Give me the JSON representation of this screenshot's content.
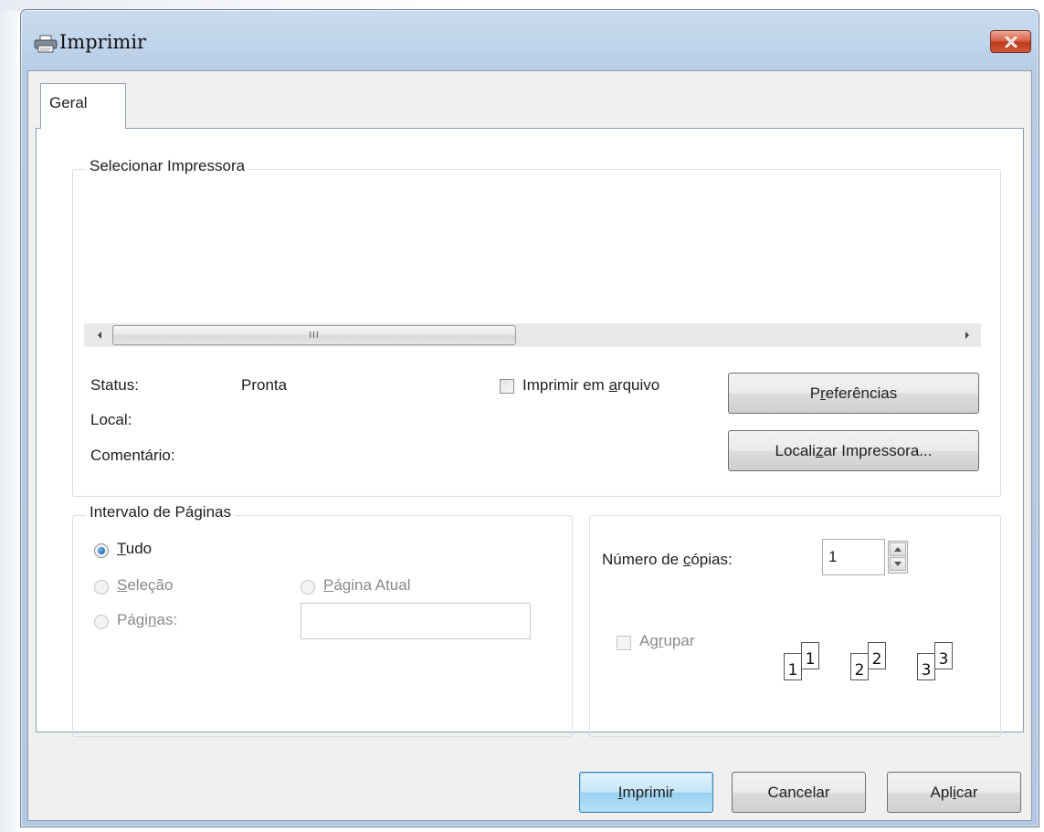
{
  "window": {
    "title": "Imprimir",
    "icon": "printer-icon",
    "close_icon": "close-icon"
  },
  "tabs": [
    {
      "label": "Geral"
    }
  ],
  "printer_group": {
    "legend": "Selecionar Impressora",
    "status_label": "Status:",
    "status_value": "Pronta",
    "local_label": "Local:",
    "comment_label": "Comentário:",
    "print_to_file": {
      "before": "Imprimir em ",
      "access": "a",
      "after": "rquivo",
      "checked": false
    },
    "preferences_button": {
      "before": "P",
      "access": "r",
      "after": "eferências"
    },
    "find_printer_button": {
      "before": "Locali",
      "access": "z",
      "after": "ar Impressora..."
    },
    "scroll_grip": "III"
  },
  "page_range": {
    "legend": "Intervalo de Páginas",
    "all": {
      "access": "T",
      "after": "udo",
      "selected": true
    },
    "selection": {
      "access": "S",
      "after": "eleção",
      "enabled": false
    },
    "current_page": {
      "access": "P",
      "after": "ágina Atual",
      "enabled": false
    },
    "pages": {
      "before": "Pági",
      "access": "n",
      "after": "as:",
      "enabled": false
    },
    "pages_input_value": ""
  },
  "copies": {
    "label_before": "Número de ",
    "label_access": "c",
    "label_after": "ópias:",
    "value": "1",
    "collate": {
      "before": "Ag",
      "access": "r",
      "after": "upar",
      "checked": false,
      "enabled": false
    },
    "collate_pages": [
      "1",
      "2",
      "3"
    ]
  },
  "buttons": {
    "print": {
      "access": "I",
      "after": "mprimir"
    },
    "cancel": {
      "label": "Cancelar"
    },
    "apply": {
      "before": "Apl",
      "access": "i",
      "after": "car"
    }
  }
}
